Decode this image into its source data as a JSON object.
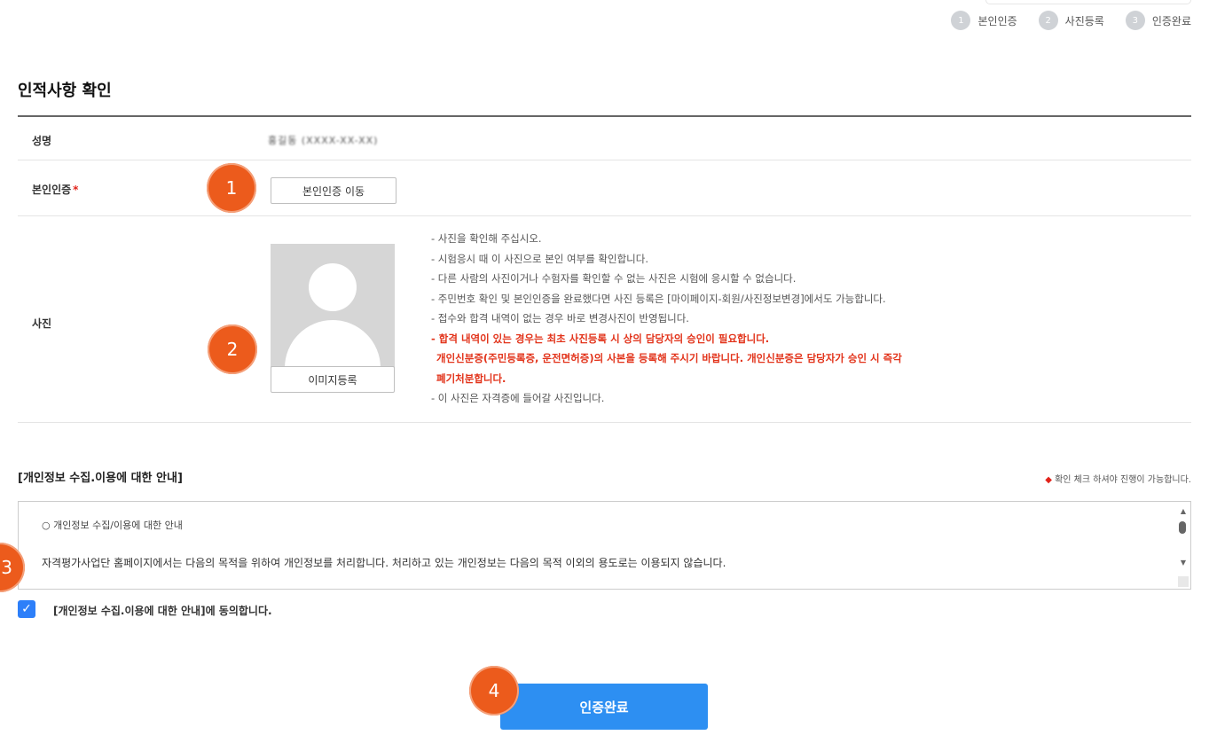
{
  "steps": [
    {
      "num": "1",
      "label": "본인인증"
    },
    {
      "num": "2",
      "label": "사진등록"
    },
    {
      "num": "3",
      "label": "인증완료"
    }
  ],
  "section_title": "인적사항 확인",
  "form": {
    "name_label": "성명",
    "name_value": "홍길동 (XXXX-XX-XX)",
    "verify_label": "본인인증",
    "verify_required_mark": "*",
    "verify_button": "본인인증 이동",
    "photo_label": "사진",
    "photo_button": "이미지등록"
  },
  "notes": [
    {
      "text": "- 사진을 확인해 주십시오.",
      "highlight": false
    },
    {
      "text": "- 시험응시 때 이 사진으로 본인 여부를 확인합니다.",
      "highlight": false
    },
    {
      "text": "- 다른 사람의 사진이거나 수험자를 확인할 수 없는 사진은 시험에 응시할 수 없습니다.",
      "highlight": false
    },
    {
      "text": "- 주민번호 확인 및 본인인증을 완료했다면 사진 등록은 [마이페이지-회원/사진정보변경]에서도 가능합니다.",
      "highlight": false
    },
    {
      "text": "- 접수와 합격 내역이 없는 경우 바로 변경사진이 반영됩니다.",
      "highlight": false
    },
    {
      "text": "- 합격 내역이 있는 경우는 최초 사진등록 시 상의 담당자의 승인이 필요합니다.",
      "highlight": true
    },
    {
      "text": "  개인신분증(주민등록증, 운전면허증)의 사본을 등록해 주시기 바랍니다. 개인신분증은 담당자가 승인 시 즉각",
      "highlight": true
    },
    {
      "text": "  폐기처분합니다.",
      "highlight": true
    },
    {
      "text": "- 이 사진은 자격증에 들어갈 사진입니다.",
      "highlight": false
    }
  ],
  "privacy": {
    "title": "[개인정보 수집.이용에 대한 안내]",
    "note_marker": "◆",
    "note": "확인 체크 하셔야 진행이 가능합니다.",
    "box_heading": "○ 개인정보 수집/이용에 대한 안내",
    "box_text": "자격평가사업단 홈페이지에서는 다음의 목적을 위하여 개인정보를 처리합니다. 처리하고 있는 개인정보는 다음의 목적 이외의 용도로는 이용되지 않습니다.",
    "scroll_up_icon": "▲",
    "scroll_down_icon": "▼"
  },
  "agree": {
    "checked": true,
    "check_icon": "✓",
    "label": "[개인정보 수집.이용에 대한 안내]에 동의합니다."
  },
  "submit_button": "인증완료",
  "callouts": [
    "1",
    "2",
    "3",
    "4"
  ],
  "colors": {
    "accent_blue": "#2d8ff2",
    "callout_orange": "#ec5b1c",
    "warning_red": "#e2331a"
  }
}
